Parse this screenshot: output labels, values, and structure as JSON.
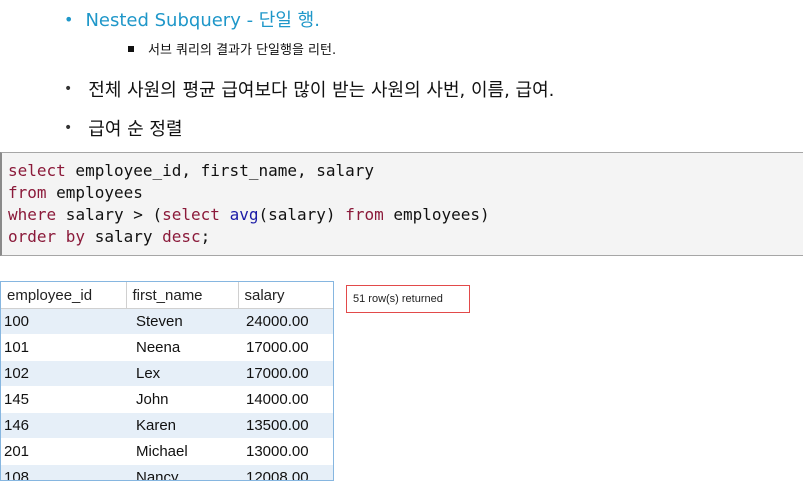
{
  "bullets": {
    "heading": "Nested Subquery - 단일 행.",
    "sub": "서브 쿼리의 결과가 단일행을 리턴.",
    "desc": "전체 사원의 평균 급여보다 많이 받는 사원의 사번, 이름, 급여.",
    "sort": "급여 순 정렬"
  },
  "code": {
    "l1_kw": "select",
    "l1_rest": " employee_id, first_name, salary",
    "l2_kw": "from",
    "l2_rest": " employees",
    "l3_kw1": "where",
    "l3_a": " salary > (",
    "l3_kw2": "select",
    "l3_sp": " ",
    "l3_fn": "avg",
    "l3_b": "(salary) ",
    "l3_kw3": "from",
    "l3_c": " employees)",
    "l4_kw": "order by",
    "l4_a": " salary ",
    "l4_kw2": "desc",
    "l4_b": ";"
  },
  "result": {
    "columns": [
      "employee_id",
      "first_name",
      "salary"
    ],
    "rows": [
      [
        "100",
        "Steven",
        "24000.00"
      ],
      [
        "101",
        "Neena",
        "17000.00"
      ],
      [
        "102",
        "Lex",
        "17000.00"
      ],
      [
        "145",
        "John",
        "14000.00"
      ],
      [
        "146",
        "Karen",
        "13500.00"
      ],
      [
        "201",
        "Michael",
        "13000.00"
      ],
      [
        "108",
        "Nancy",
        "12008.00"
      ]
    ]
  },
  "status": "51 row(s) returned",
  "colors": {
    "accent": "#1f97c9",
    "keyword": "#8b1a3a",
    "function": "#1a1aa6",
    "status_border": "#e24a4a"
  }
}
